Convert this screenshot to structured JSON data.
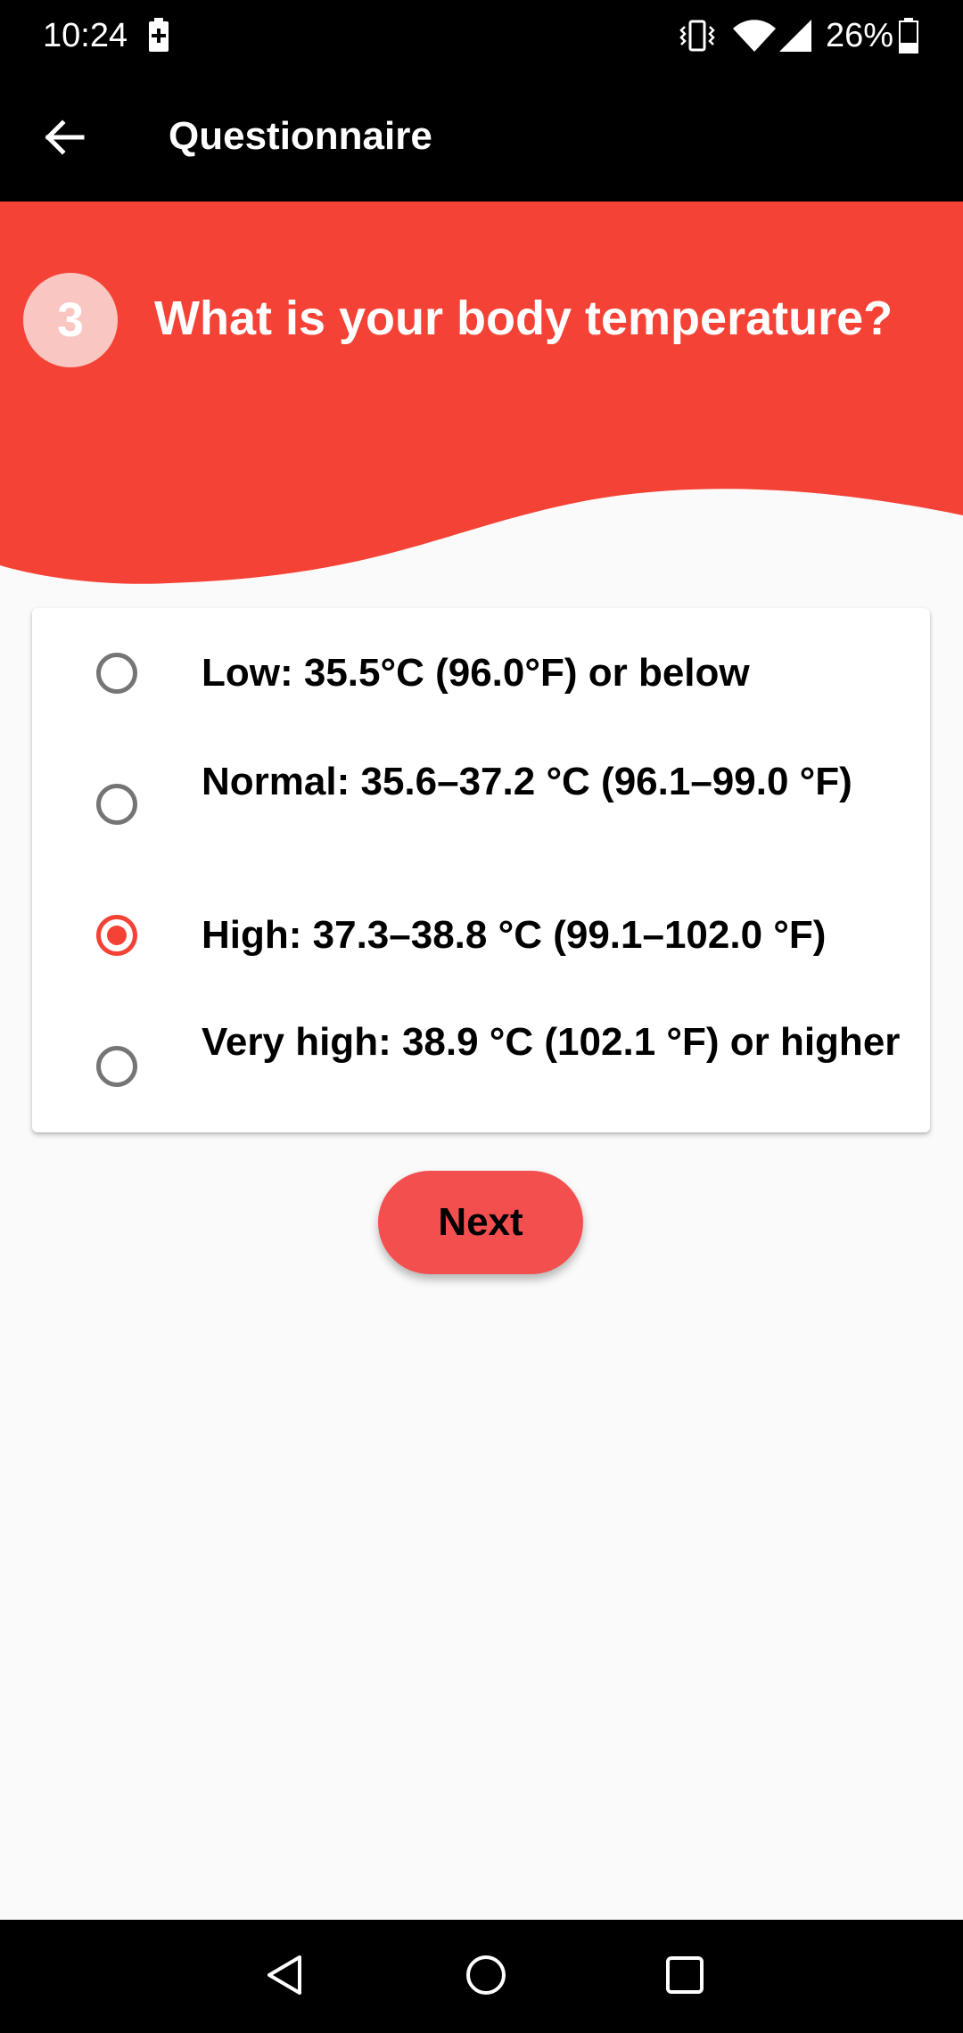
{
  "status_bar": {
    "time": "10:24",
    "battery_percent": "26%",
    "icons": [
      "charging-icon",
      "vibrate-icon",
      "wifi-icon",
      "signal-icon",
      "battery-icon"
    ]
  },
  "app_bar": {
    "title": "Questionnaire",
    "back_icon": "arrow-left-icon"
  },
  "question": {
    "step": "3",
    "title": "What is your body temperature?"
  },
  "options": [
    {
      "label": "Low: 35.5°C (96.0°F) or below",
      "selected": false
    },
    {
      "label": "Normal: 35.6–37.2 °C (96.1–99.0 °F)",
      "selected": false
    },
    {
      "label": "High: 37.3–38.8 °C (99.1–102.0 °F)",
      "selected": true
    },
    {
      "label": "Very high: 38.9 °C (102.1 °F) or higher",
      "selected": false
    }
  ],
  "next_button": {
    "label": "Next"
  },
  "colors": {
    "accent": "#f44336",
    "header": "#f44336",
    "button": "#f44f4f",
    "badge": "#f9c6c1",
    "background": "#fafafa"
  },
  "nav_bar": {
    "icons": [
      "nav-back-icon",
      "nav-home-icon",
      "nav-recents-icon"
    ]
  }
}
